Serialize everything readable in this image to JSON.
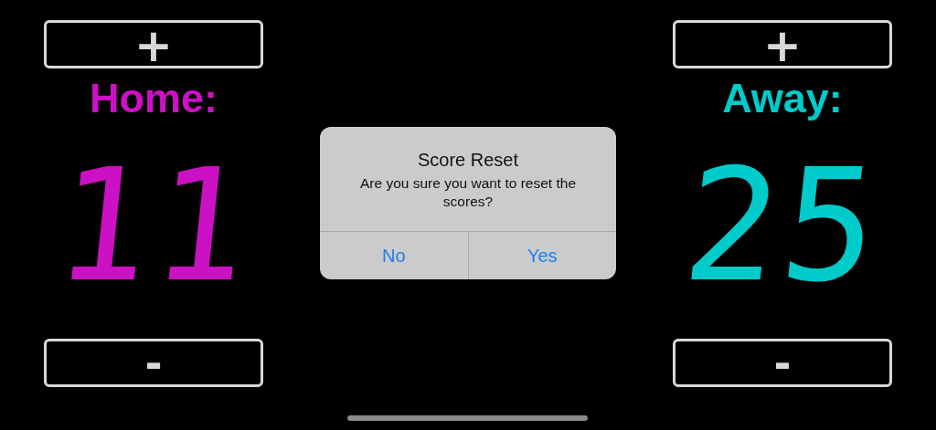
{
  "teams": [
    {
      "name": "Home:",
      "score": "11",
      "color": "#cc11c4",
      "plus": "+",
      "minus": "-"
    },
    {
      "name": "Away:",
      "score": "25",
      "color": "#00cbcb",
      "plus": "+",
      "minus": "-"
    }
  ],
  "dialog": {
    "title": "Score Reset",
    "message": "Are you sure you want to reset the scores?",
    "buttons": [
      {
        "label": "No"
      },
      {
        "label": "Yes"
      }
    ]
  }
}
